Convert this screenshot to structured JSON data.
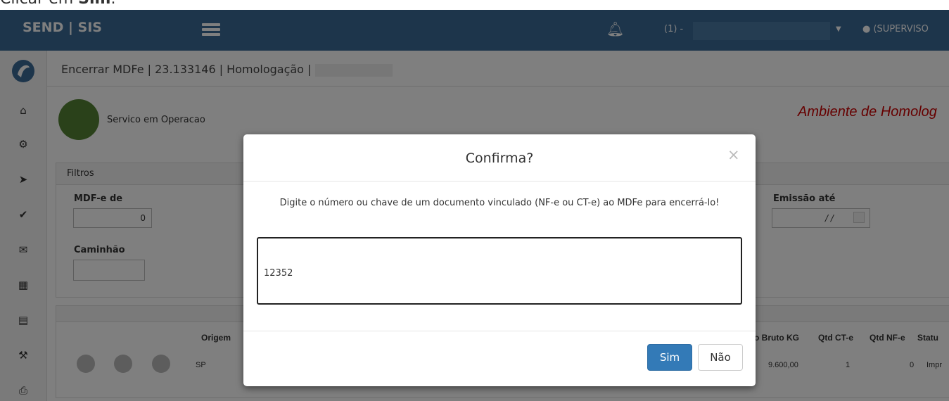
{
  "caption": {
    "prefix": "Clicar em ",
    "bold": "Sim",
    "suffix": "."
  },
  "topbar": {
    "brand": "SEND | SIS",
    "notification_count": "(1) -",
    "user": "(SUPERVISO"
  },
  "page": {
    "title": "Encerrar MDFe | 23.133146 | Homologação |"
  },
  "status": {
    "text": "Servico em Operacao",
    "color": "#548235"
  },
  "environment": "Ambiente de Homolog",
  "filters": {
    "title": "Filtros",
    "mdfe_label": "MDF-e de",
    "mdfe_value": "0",
    "caminhao_label": "Caminhão",
    "emissao_label": "Emissão até",
    "emissao_value": "/ /"
  },
  "table": {
    "headers": {
      "origem": "Origem",
      "bruto": "o Bruto KG",
      "qtd_cte": "Qtd CT-e",
      "qtd_nfe": "Qtd NF-e",
      "status": "Statu"
    },
    "row": {
      "origem": "SP",
      "bruto": "9.600,00",
      "qtd_cte": "1",
      "qtd_nfe": "0",
      "status": "Impr"
    }
  },
  "modal": {
    "title": "Confirma?",
    "close": "×",
    "message": "Digite o número ou chave de um documento vinculado (NF-e ou CT-e) ao MDFe para encerrá-lo!",
    "input_value": "12352",
    "yes": "Sim",
    "no": "Não"
  },
  "colors": {
    "topbar": "#3a6a97",
    "primary": "#337ab7",
    "env": "#cc0000"
  }
}
